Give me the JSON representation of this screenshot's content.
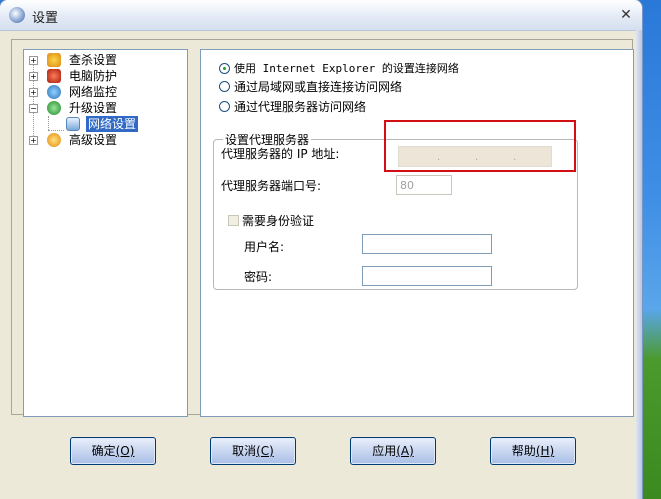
{
  "window": {
    "title": "设置",
    "close_glyph": "✕"
  },
  "tree": {
    "items": [
      {
        "label": "查杀设置",
        "icon": "scan-icon",
        "expander": "+"
      },
      {
        "label": "电脑防护",
        "icon": "shield-magnet-icon",
        "expander": "+"
      },
      {
        "label": "网络监控",
        "icon": "network-globe-icon",
        "expander": "+"
      },
      {
        "label": "升级设置",
        "icon": "update-icon",
        "expander": "−"
      },
      {
        "label": "网络设置",
        "icon": "network-settings-icon",
        "selected": true
      },
      {
        "label": "高级设置",
        "icon": "gear-icon",
        "expander": "+"
      }
    ]
  },
  "network": {
    "options": [
      {
        "label": "使用 Internet Explorer 的设置连接网络",
        "checked": true
      },
      {
        "label": "通过局域网或直接连接访问网络",
        "checked": false
      },
      {
        "label": "通过代理服务器访问网络",
        "checked": false
      }
    ],
    "proxy": {
      "group_title": "设置代理服务器",
      "ip_label": "代理服务器的 IP 地址:",
      "ip_separators": [
        ".",
        ".",
        "."
      ],
      "port_label": "代理服务器端口号:",
      "port_value": "80",
      "auth_label": "需要身份验证",
      "auth_checked": false,
      "username_label": "用户名:",
      "username_value": "",
      "password_label": "密码:",
      "password_value": ""
    }
  },
  "buttons": {
    "ok": {
      "label": "确定",
      "shortcut": "(O)"
    },
    "cancel": {
      "label": "取消",
      "shortcut": "(C)"
    },
    "apply": {
      "label": "应用",
      "shortcut": "(A)"
    },
    "help": {
      "label": "帮助",
      "shortcut": "(H)"
    }
  },
  "colors": {
    "highlight_border": "#d40f14",
    "selected_bg": "#316ac5",
    "window_bg": "#ece9d8"
  }
}
